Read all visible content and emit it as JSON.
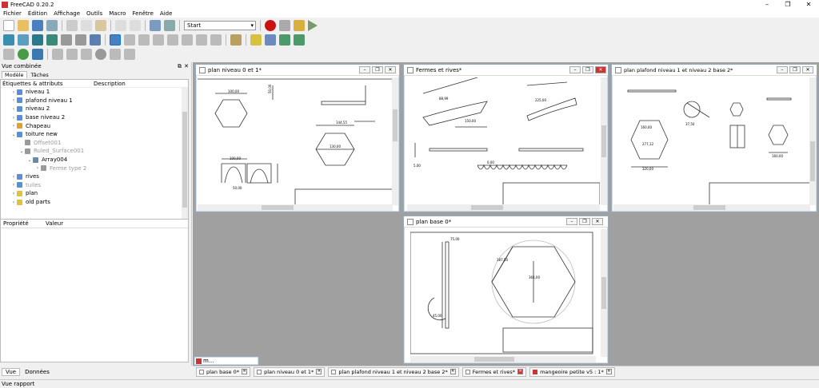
{
  "window": {
    "title": "FreeCAD 0.20.2"
  },
  "menu": [
    "Fichier",
    "Édition",
    "Affichage",
    "Outils",
    "Macro",
    "Fenêtre",
    "Aide"
  ],
  "toolbar": {
    "workbench": "Start"
  },
  "combo": {
    "title": "Vue combinée",
    "tab_model": "Modèle",
    "tab_tasks": "Tâches",
    "col_labels": "Étiquettes & attributs",
    "col_desc": "Description"
  },
  "tree": [
    {
      "label": "niveau 1",
      "depth": 0,
      "expand": "›",
      "color": "#5a8fd8",
      "dim": false
    },
    {
      "label": "plafond niveau 1",
      "depth": 0,
      "expand": "›",
      "color": "#5a8fd8",
      "dim": false
    },
    {
      "label": "niveau 2",
      "depth": 0,
      "expand": "›",
      "color": "#5a8fd8",
      "dim": false
    },
    {
      "label": "base niveau 2",
      "depth": 0,
      "expand": "›",
      "color": "#5a8fd8",
      "dim": false
    },
    {
      "label": "Chapeau",
      "depth": 0,
      "expand": "›",
      "color": "#e0a030",
      "dim": false
    },
    {
      "label": "toiture new",
      "depth": 0,
      "expand": "⌄",
      "color": "#5a8fd8",
      "dim": false
    },
    {
      "label": "Offset001",
      "depth": 1,
      "expand": "",
      "color": "#999",
      "dim": true
    },
    {
      "label": "Ruled_Surface001",
      "depth": 1,
      "expand": "⌄",
      "color": "#999",
      "dim": true
    },
    {
      "label": "Array004",
      "depth": 2,
      "expand": "⌄",
      "color": "#6a8aa8",
      "dim": false
    },
    {
      "label": "Ferme type 2",
      "depth": 3,
      "expand": "›",
      "color": "#999",
      "dim": true
    },
    {
      "label": "rives",
      "depth": 0,
      "expand": "›",
      "color": "#5a8fd8",
      "dim": false
    },
    {
      "label": "tuiles",
      "depth": 0,
      "expand": "›",
      "color": "#5a8fd8",
      "dim": true
    },
    {
      "label": "plan",
      "depth": 0,
      "expand": "›",
      "color": "#e0c040",
      "dim": false
    },
    {
      "label": "old parts",
      "depth": 0,
      "expand": "›",
      "color": "#e0c040",
      "dim": false
    }
  ],
  "props": {
    "col_prop": "Propriété",
    "col_val": "Valeur"
  },
  "bottom_tabs": {
    "view": "Vue",
    "data": "Données"
  },
  "subwindows": {
    "w1": "plan niveau 0 et 1*",
    "w2": "Fermes et rives*",
    "w3": "plan plafond niveau 1 et niveau 2 base 2*",
    "w4": "plan base 0*",
    "min": "m..."
  },
  "doc_tabs": [
    "plan base 0*",
    "plan niveau 0 et 1*",
    "plan plafond niveau 1 et niveau 2 base 2*",
    "Fermes et rives*",
    "mangeoire petite v5 : 1*"
  ],
  "status": "Vue rapport",
  "colors": {
    "accent": "#0078d7",
    "record": "#cc1111"
  }
}
